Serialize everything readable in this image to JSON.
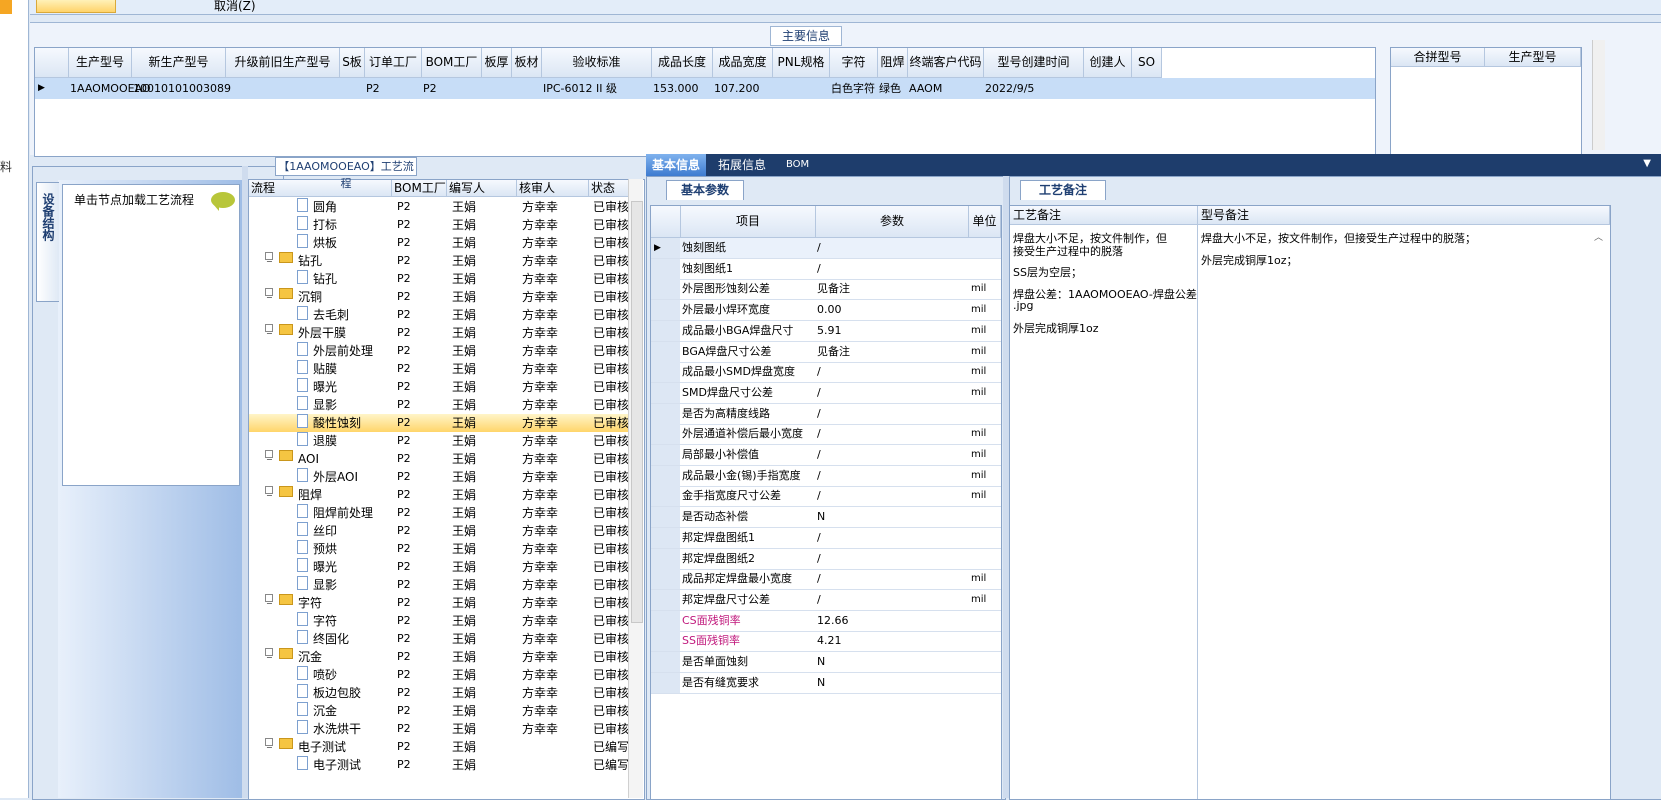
{
  "top": {
    "cancel_label": "取消(Z)"
  },
  "left_strip": {
    "char": "料"
  },
  "main_info": {
    "title": "主要信息",
    "columns": [
      "生产型号",
      "新生产型号",
      "升级前旧生产型号",
      "S板",
      "订单工厂",
      "BOM工厂",
      "板厚",
      "板材",
      "验收标准",
      "成品长度",
      "成品宽度",
      "PNL规格",
      "字符",
      "阻焊",
      "终端客户代码",
      "型号创建时间",
      "创建人",
      "SO"
    ],
    "row": [
      "1AAOMOOEAO",
      "10010101003089",
      "",
      "",
      "P2",
      "P2",
      "",
      "",
      "IPC-6012 II 级",
      "153.000",
      "107.200",
      "",
      "白色字符",
      "绿色",
      "AAOM",
      "2022/9/5",
      "",
      ""
    ],
    "side_columns": [
      "合拼型号",
      "生产型号"
    ]
  },
  "left_panel": {
    "vertical_tab": "设备结构",
    "hint": "单击节点加载工艺流程"
  },
  "process_tree": {
    "title": "【1AAOMOOEAO】工艺流程",
    "columns": [
      "流程",
      "BOM工厂",
      "编写人",
      "核审人",
      "状态"
    ],
    "rows": [
      {
        "type": "doc",
        "level": 2,
        "name": "圆角",
        "bom": "P2",
        "writer": "王娟",
        "reviewer": "方幸幸",
        "status": "已审核"
      },
      {
        "type": "doc",
        "level": 2,
        "name": "打标",
        "bom": "P2",
        "writer": "王娟",
        "reviewer": "方幸幸",
        "status": "已审核"
      },
      {
        "type": "doc",
        "level": 2,
        "name": "烘板",
        "bom": "P2",
        "writer": "王娟",
        "reviewer": "方幸幸",
        "status": "已审核"
      },
      {
        "type": "folder",
        "level": 1,
        "name": "钻孔",
        "bom": "P2",
        "writer": "王娟",
        "reviewer": "方幸幸",
        "status": "已审核"
      },
      {
        "type": "doc",
        "level": 2,
        "name": "钻孔",
        "bom": "P2",
        "writer": "王娟",
        "reviewer": "方幸幸",
        "status": "已审核"
      },
      {
        "type": "folder",
        "level": 1,
        "name": "沉铜",
        "bom": "P2",
        "writer": "王娟",
        "reviewer": "方幸幸",
        "status": "已审核"
      },
      {
        "type": "doc",
        "level": 2,
        "name": "去毛刺",
        "bom": "P2",
        "writer": "王娟",
        "reviewer": "方幸幸",
        "status": "已审核"
      },
      {
        "type": "folder",
        "level": 1,
        "name": "外层干膜",
        "bom": "P2",
        "writer": "王娟",
        "reviewer": "方幸幸",
        "status": "已审核"
      },
      {
        "type": "doc",
        "level": 2,
        "name": "外层前处理",
        "bom": "P2",
        "writer": "王娟",
        "reviewer": "方幸幸",
        "status": "已审核"
      },
      {
        "type": "doc",
        "level": 2,
        "name": "贴膜",
        "bom": "P2",
        "writer": "王娟",
        "reviewer": "方幸幸",
        "status": "已审核"
      },
      {
        "type": "doc",
        "level": 2,
        "name": "曝光",
        "bom": "P2",
        "writer": "王娟",
        "reviewer": "方幸幸",
        "status": "已审核"
      },
      {
        "type": "doc",
        "level": 2,
        "name": "显影",
        "bom": "P2",
        "writer": "王娟",
        "reviewer": "方幸幸",
        "status": "已审核"
      },
      {
        "type": "doc",
        "level": 2,
        "name": "酸性蚀刻",
        "bom": "P2",
        "writer": "王娟",
        "reviewer": "方幸幸",
        "status": "已审核",
        "selected": true
      },
      {
        "type": "doc",
        "level": 2,
        "name": "退膜",
        "bom": "P2",
        "writer": "王娟",
        "reviewer": "方幸幸",
        "status": "已审核"
      },
      {
        "type": "folder",
        "level": 1,
        "name": "AOI",
        "bom": "P2",
        "writer": "王娟",
        "reviewer": "方幸幸",
        "status": "已审核"
      },
      {
        "type": "doc",
        "level": 2,
        "name": "外层AOI",
        "bom": "P2",
        "writer": "王娟",
        "reviewer": "方幸幸",
        "status": "已审核"
      },
      {
        "type": "folder",
        "level": 1,
        "name": "阻焊",
        "bom": "P2",
        "writer": "王娟",
        "reviewer": "方幸幸",
        "status": "已审核"
      },
      {
        "type": "doc",
        "level": 2,
        "name": "阻焊前处理",
        "bom": "P2",
        "writer": "王娟",
        "reviewer": "方幸幸",
        "status": "已审核"
      },
      {
        "type": "doc",
        "level": 2,
        "name": "丝印",
        "bom": "P2",
        "writer": "王娟",
        "reviewer": "方幸幸",
        "status": "已审核"
      },
      {
        "type": "doc",
        "level": 2,
        "name": "预烘",
        "bom": "P2",
        "writer": "王娟",
        "reviewer": "方幸幸",
        "status": "已审核"
      },
      {
        "type": "doc",
        "level": 2,
        "name": "曝光",
        "bom": "P2",
        "writer": "王娟",
        "reviewer": "方幸幸",
        "status": "已审核"
      },
      {
        "type": "doc",
        "level": 2,
        "name": "显影",
        "bom": "P2",
        "writer": "王娟",
        "reviewer": "方幸幸",
        "status": "已审核"
      },
      {
        "type": "folder",
        "level": 1,
        "name": "字符",
        "bom": "P2",
        "writer": "王娟",
        "reviewer": "方幸幸",
        "status": "已审核"
      },
      {
        "type": "doc",
        "level": 2,
        "name": "字符",
        "bom": "P2",
        "writer": "王娟",
        "reviewer": "方幸幸",
        "status": "已审核"
      },
      {
        "type": "doc",
        "level": 2,
        "name": "终固化",
        "bom": "P2",
        "writer": "王娟",
        "reviewer": "方幸幸",
        "status": "已审核"
      },
      {
        "type": "folder",
        "level": 1,
        "name": "沉金",
        "bom": "P2",
        "writer": "王娟",
        "reviewer": "方幸幸",
        "status": "已审核"
      },
      {
        "type": "doc",
        "level": 2,
        "name": "喷砂",
        "bom": "P2",
        "writer": "王娟",
        "reviewer": "方幸幸",
        "status": "已审核"
      },
      {
        "type": "doc",
        "level": 2,
        "name": "板边包胶",
        "bom": "P2",
        "writer": "王娟",
        "reviewer": "方幸幸",
        "status": "已审核"
      },
      {
        "type": "doc",
        "level": 2,
        "name": "沉金",
        "bom": "P2",
        "writer": "王娟",
        "reviewer": "方幸幸",
        "status": "已审核"
      },
      {
        "type": "doc",
        "level": 2,
        "name": "水洗烘干",
        "bom": "P2",
        "writer": "王娟",
        "reviewer": "方幸幸",
        "status": "已审核"
      },
      {
        "type": "folder",
        "level": 1,
        "name": "电子测试",
        "bom": "P2",
        "writer": "王娟",
        "reviewer": "",
        "status": "已编写"
      },
      {
        "type": "doc",
        "level": 2,
        "name": "电子测试",
        "bom": "P2",
        "writer": "王娟",
        "reviewer": "",
        "status": "已编写"
      }
    ]
  },
  "right_tabs": [
    "基本信息",
    "拓展信息",
    "BOM"
  ],
  "basic_params": {
    "title": "基本参数",
    "columns": [
      "项目",
      "参数",
      "单位"
    ],
    "rows": [
      {
        "item": "蚀刻图纸",
        "value": "/",
        "unit": "",
        "pink": false
      },
      {
        "item": "蚀刻图纸1",
        "value": "/",
        "unit": "",
        "pink": false
      },
      {
        "item": "外层图形蚀刻公差",
        "value": "见备注",
        "unit": "mil",
        "pink": false
      },
      {
        "item": "外层最小焊环宽度",
        "value": "0.00",
        "unit": "mil",
        "pink": false
      },
      {
        "item": "成品最小BGA焊盘尺寸",
        "value": "5.91",
        "unit": "mil",
        "pink": false
      },
      {
        "item": "BGA焊盘尺寸公差",
        "value": "见备注",
        "unit": "mil",
        "pink": false
      },
      {
        "item": "成品最小SMD焊盘宽度",
        "value": "/",
        "unit": "mil",
        "pink": false
      },
      {
        "item": "SMD焊盘尺寸公差",
        "value": "/",
        "unit": "mil",
        "pink": false
      },
      {
        "item": "是否为高精度线路",
        "value": "/",
        "unit": "",
        "pink": false
      },
      {
        "item": "外层通道补偿后最小宽度",
        "value": "/",
        "unit": "mil",
        "pink": false
      },
      {
        "item": "局部最小补偿值",
        "value": "/",
        "unit": "mil",
        "pink": false
      },
      {
        "item": "成品最小金(锡)手指宽度",
        "value": "/",
        "unit": "mil",
        "pink": false
      },
      {
        "item": "金手指宽度尺寸公差",
        "value": "/",
        "unit": "mil",
        "pink": false
      },
      {
        "item": "是否动态补偿",
        "value": "N",
        "unit": "",
        "pink": false
      },
      {
        "item": "邦定焊盘图纸1",
        "value": "/",
        "unit": "",
        "pink": false
      },
      {
        "item": "邦定焊盘图纸2",
        "value": "/",
        "unit": "",
        "pink": false
      },
      {
        "item": "成品邦定焊盘最小宽度",
        "value": "/",
        "unit": "mil",
        "pink": false
      },
      {
        "item": "邦定焊盘尺寸公差",
        "value": "/",
        "unit": "mil",
        "pink": false
      },
      {
        "item": "CS面残铜率",
        "value": "12.66",
        "unit": "",
        "pink": true
      },
      {
        "item": "SS面残铜率",
        "value": "4.21",
        "unit": "",
        "pink": true
      },
      {
        "item": "是否单面蚀刻",
        "value": "N",
        "unit": "",
        "pink": false
      },
      {
        "item": "是否有缝宽要求",
        "value": "N",
        "unit": "",
        "pink": false
      }
    ]
  },
  "process_notes": {
    "title": "工艺备注",
    "columns": [
      "工艺备注",
      "型号备注"
    ],
    "left_lines": [
      "焊盘大小不足，按文件制作，但",
      "接受生产过程中的脱落",
      "",
      "SS层为空层；",
      "",
      "焊盘公差：1AAOMOOEAO-焊盘公差",
      ".jpg",
      "",
      "外层完成铜厚1oz"
    ],
    "right_lines": [
      "焊盘大小不足，按文件制作，但接受生产过程中的脱落；",
      "",
      "外层完成铜厚1oz；"
    ]
  },
  "colors": {
    "selection": "#c7ddf7",
    "tab_active": "#3d7bd0",
    "pink_text": "#c0187c",
    "folder": "#f5c542"
  }
}
